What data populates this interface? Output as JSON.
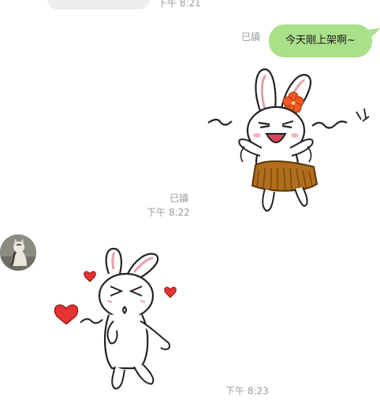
{
  "chat": {
    "top_message": {
      "time": "下午 8:21"
    },
    "outgoing_text": {
      "read_label": "已讀",
      "text": "今天剛上架啊~",
      "bubble_color": "#a9e08a"
    },
    "outgoing_sticker": {
      "sticker_name": "hula-bunny-sticker",
      "read_label": "已讀",
      "time": "下午 8:22"
    },
    "incoming_sticker": {
      "avatar_name": "cat-avatar",
      "sticker_name": "kissing-bunny-sticker",
      "time": "下午 8:23"
    }
  }
}
